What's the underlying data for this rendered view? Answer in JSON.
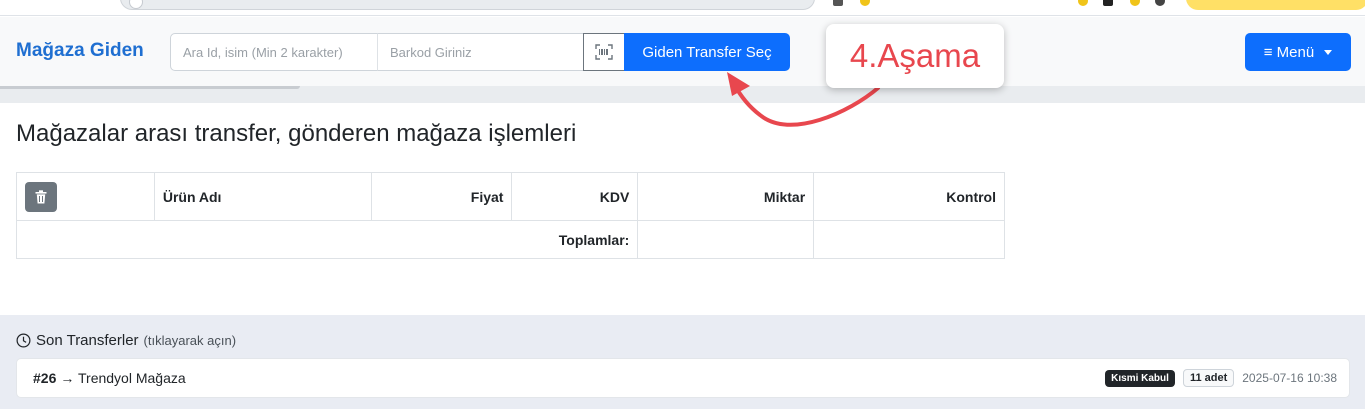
{
  "navbar": {
    "brand": "Mağaza Giden",
    "search_placeholder": "Ara Id, isim (Min 2 karakter)",
    "barcode_placeholder": "Barkod Giriniz",
    "transfer_button": "Giden Transfer Seç",
    "menu_button": "≡ Menü"
  },
  "annotation": {
    "label": "4.Aşama",
    "color": "#e8474e"
  },
  "page": {
    "title": "Mağazalar arası transfer, gönderen mağaza işlemleri"
  },
  "table": {
    "headers": [
      "Ürün Adı",
      "Fiyat",
      "KDV",
      "Miktar",
      "Kontrol"
    ],
    "totals_label": "Toplamlar:"
  },
  "recent": {
    "title": "Son Transferler",
    "hint": "(tıklayarak açın)",
    "items": [
      {
        "id": "#26",
        "target": "→ Trendyol Mağaza",
        "status": "Kısmi Kabul",
        "count": "11 adet",
        "time": "2025-07-16 10:38"
      }
    ]
  },
  "colors": {
    "primary": "#0d6efd",
    "brand": "#1f6fd1",
    "secondary": "#6c757d"
  }
}
